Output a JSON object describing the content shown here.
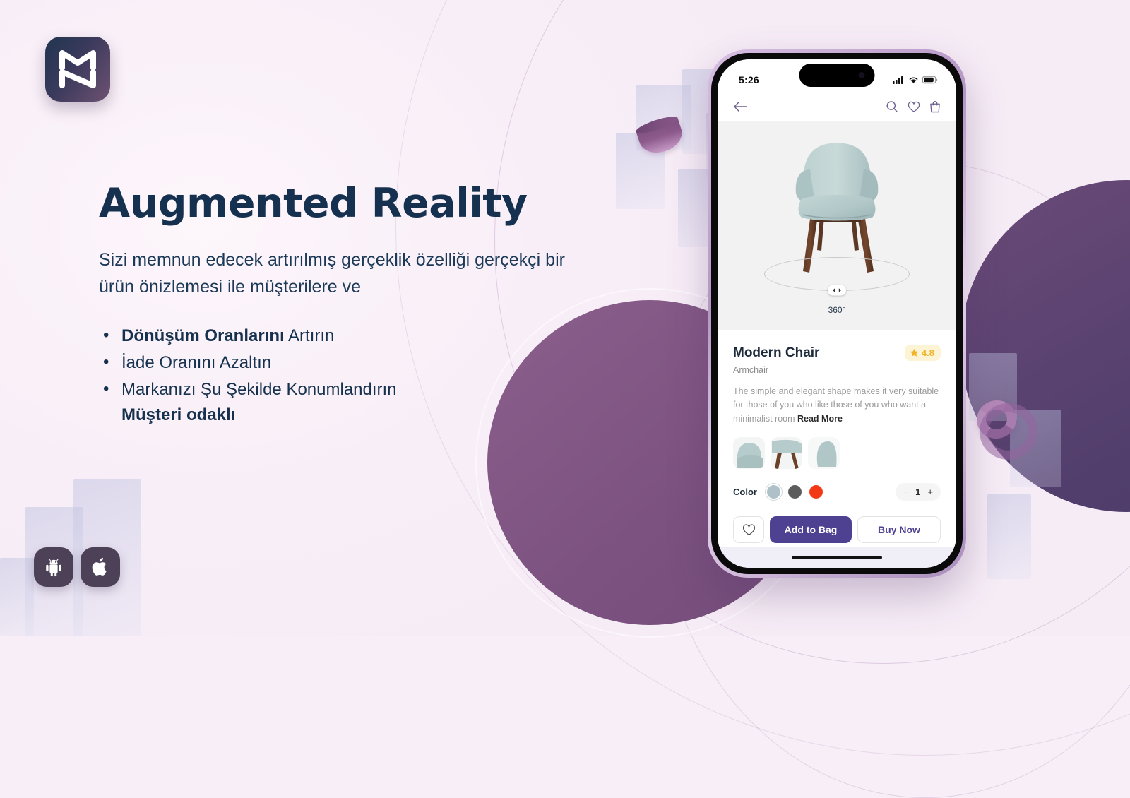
{
  "brand": {
    "logo_name": "mz-monogram-logo"
  },
  "hero": {
    "headline": "Augmented Reality",
    "subtext": "Sizi memnun edecek artırılmış gerçeklik özelliği gerçekçi bir ürün önizlemesi ile müşterilere ve",
    "bullets": [
      {
        "bold": "Dönüşüm Oranlarını",
        "rest": " Artırın"
      },
      {
        "bold": "",
        "rest": "İade Oranını Azaltın"
      },
      {
        "bold": "",
        "rest": "Markanızı Şu Şekilde Konumlandırın",
        "sub": "Müşteri odaklı"
      }
    ]
  },
  "store_badges": [
    {
      "name": "android-badge",
      "label": "Android"
    },
    {
      "name": "apple-badge",
      "label": "Apple"
    }
  ],
  "phone": {
    "status_bar": {
      "time": "5:26",
      "signal": "signal-icon",
      "wifi": "wifi-icon",
      "battery": "battery-icon"
    },
    "nav_bar": {
      "back": "back-arrow-icon",
      "search": "search-icon",
      "wishlist": "heart-icon",
      "bag": "shopping-bag-icon"
    },
    "viewer": {
      "rotate_label": "360°",
      "handle": "rotate-handle"
    },
    "product": {
      "title": "Modern Chair",
      "subtitle": "Armchair",
      "rating": "4.8",
      "rating_icon": "star-icon",
      "description": "The simple and elegant shape makes it very suitable for those of you who like those of you who want a minimalist room ",
      "read_more": "Read More",
      "thumbnails": [
        {
          "name": "thumbnail-front"
        },
        {
          "name": "thumbnail-side"
        },
        {
          "name": "thumbnail-back"
        }
      ],
      "color_label": "Color",
      "colors": [
        {
          "name": "color-swatch-sage",
          "hex": "#aec0c8",
          "selected": true
        },
        {
          "name": "color-swatch-grey",
          "hex": "#5c5c5c",
          "selected": false
        },
        {
          "name": "color-swatch-red",
          "hex": "#f23a17",
          "selected": false
        }
      ],
      "quantity": {
        "minus": "−",
        "value": "1",
        "plus": "+"
      }
    },
    "actions": {
      "favorite_icon": "heart-icon",
      "add_to_bag": "Add to Bag",
      "buy_now": "Buy Now"
    }
  },
  "colors": {
    "accent_purple": "#4f4192",
    "headline_navy": "#15314f",
    "rating_gold": "#f0b429",
    "badge_purple": "#4d4158"
  }
}
